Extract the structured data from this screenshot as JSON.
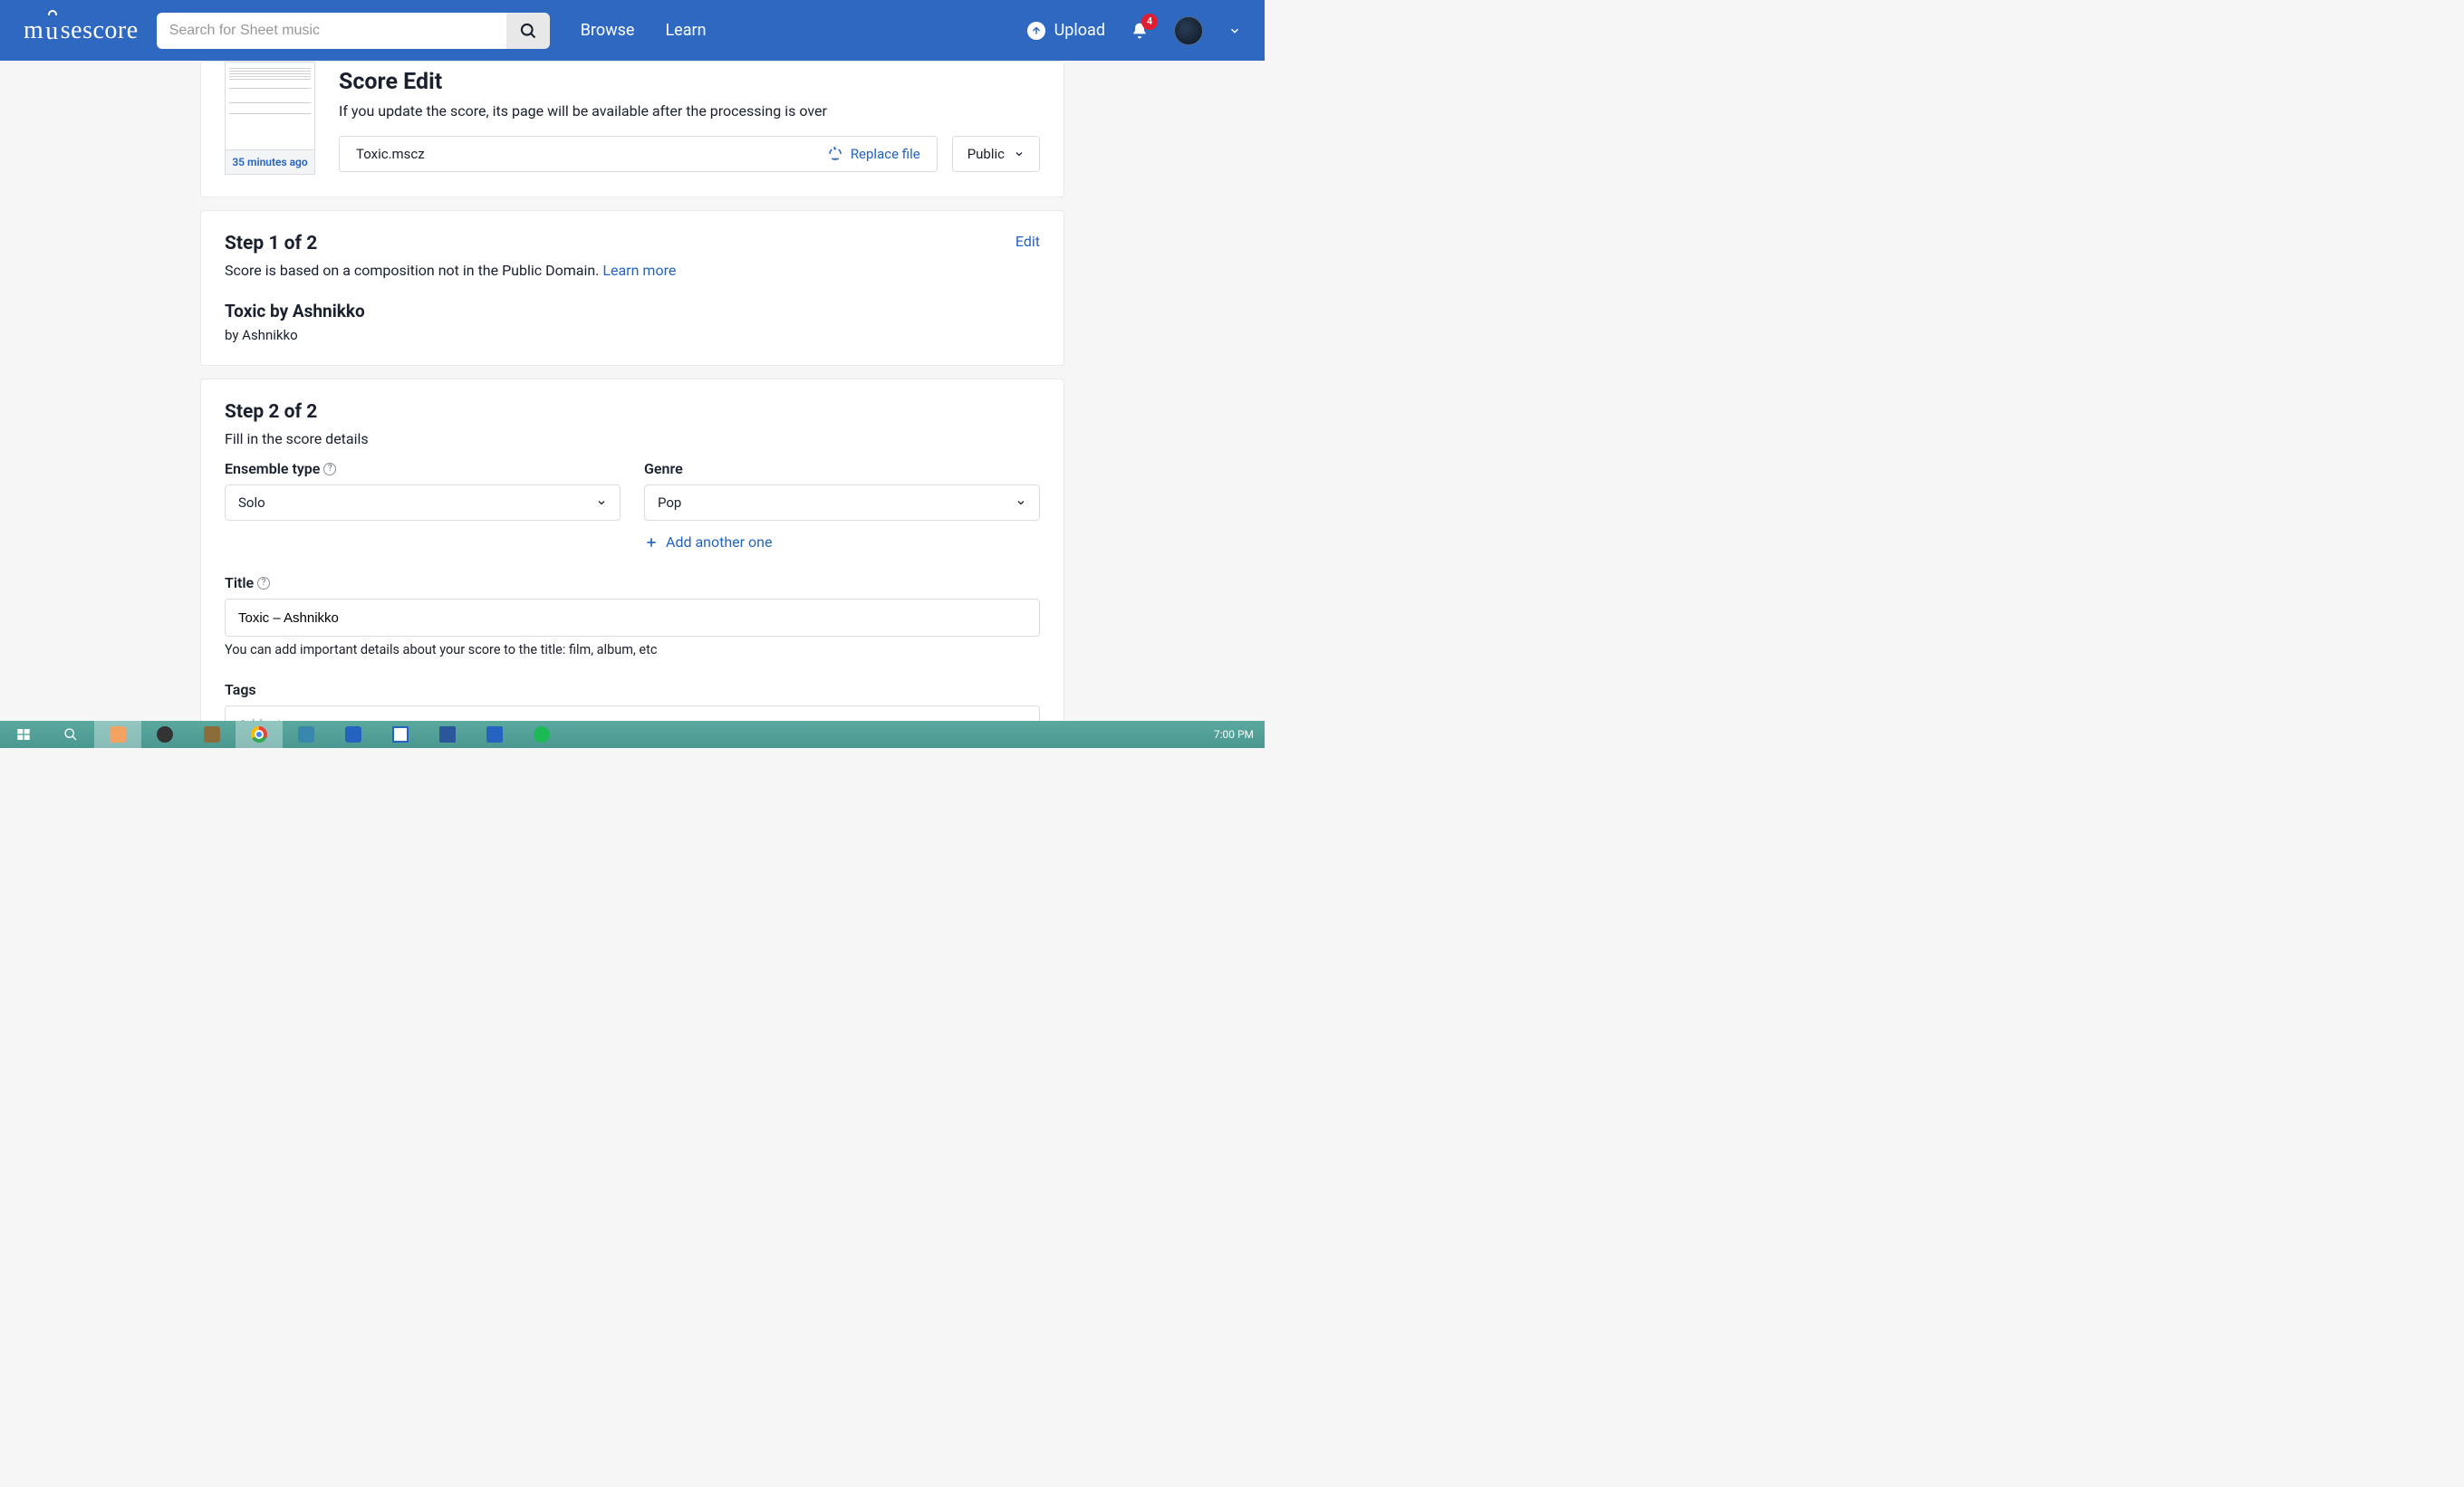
{
  "header": {
    "logo_text": "musescore",
    "search_placeholder": "Search for Sheet music",
    "nav": {
      "browse": "Browse",
      "learn": "Learn"
    },
    "upload_label": "Upload",
    "notifications_count": "4"
  },
  "score_edit": {
    "title": "Score Edit",
    "subtitle": "If you update the score, its page will be available after the processing is over",
    "thumb_time": "35 minutes ago",
    "filename": "Toxic.mscz",
    "replace_label": "Replace file",
    "visibility": "Public"
  },
  "step1": {
    "heading": "Step 1 of 2",
    "desc_prefix": "Score is based on a composition not in the Public Domain. ",
    "learn_more": "Learn more",
    "edit": "Edit",
    "song_title": "Toxic by Ashnikko",
    "byline": "by Ashnikko"
  },
  "step2": {
    "heading": "Step 2 of 2",
    "desc": "Fill in the score details",
    "ensemble_label": "Ensemble type",
    "ensemble_value": "Solo",
    "genre_label": "Genre",
    "genre_value": "Pop",
    "add_another": "Add another one",
    "title_label": "Title",
    "title_value": "Toxic – Ashnikko",
    "title_hint": "You can add important details about your score to the title: film, album, etc",
    "tags_label": "Tags",
    "tags_placeholder": "Add a tag"
  },
  "taskbar": {
    "clock": "7:00 PM"
  }
}
